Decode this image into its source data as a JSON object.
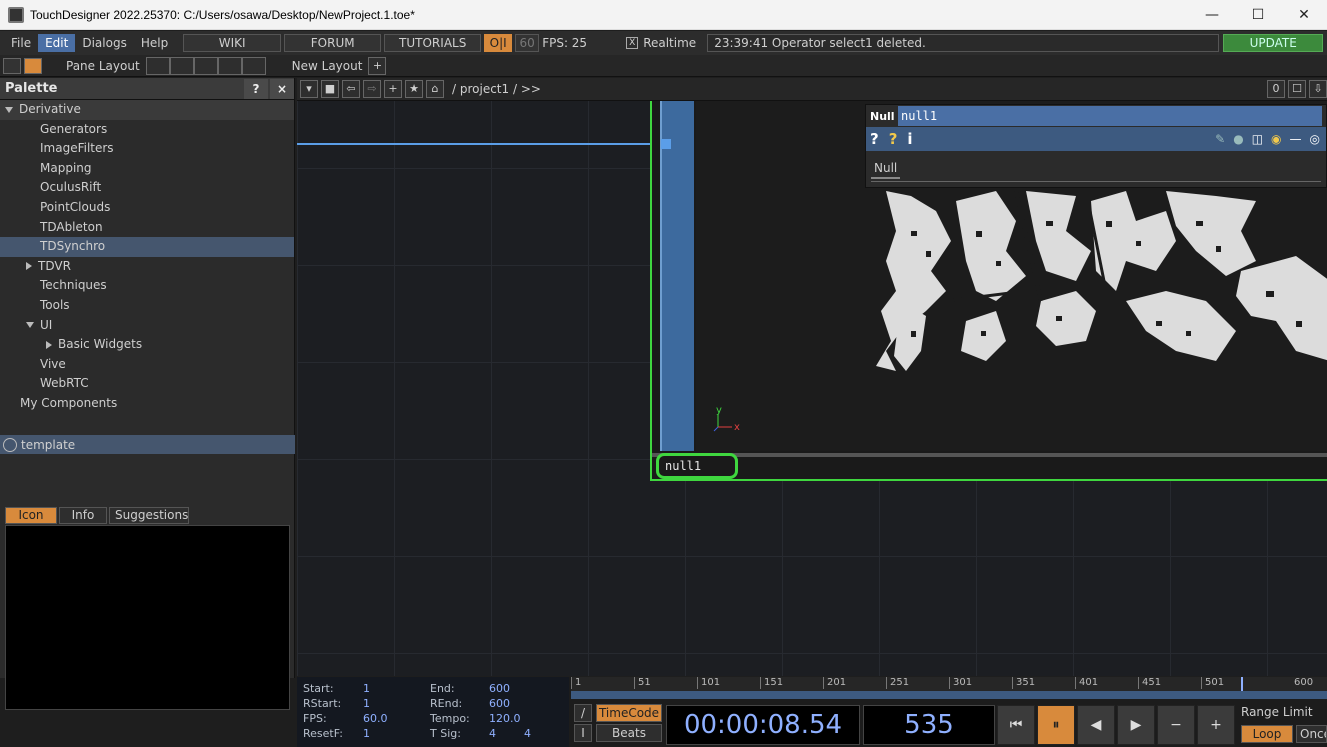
{
  "window": {
    "title": "TouchDesigner 2022.25370: C:/Users/osawa/Desktop/NewProject.1.toe*",
    "min_glyph": "—",
    "max_glyph": "☐",
    "close_glyph": "✕"
  },
  "menu": {
    "items": [
      "File",
      "Edit",
      "Dialogs",
      "Help"
    ],
    "active": "Edit",
    "wiki": "WIKI",
    "forum": "FORUM",
    "tutorials": "TUTORIALS",
    "oi": "O|I",
    "fps_cap": "60",
    "fps_label": "FPS:  25",
    "realtime_check": "X",
    "realtime": "Realtime",
    "status": "23:39:41 Operator select1 deleted.",
    "update": "UPDATE"
  },
  "layoutbar": {
    "pane_layout": "Pane Layout",
    "new_layout": "New Layout",
    "plus": "+"
  },
  "palette": {
    "title": "Palette",
    "help": "?",
    "close": "×",
    "items": [
      {
        "label": "Derivative",
        "indent": 0,
        "expand": "open",
        "group": true
      },
      {
        "label": "Generators",
        "indent": 2
      },
      {
        "label": "ImageFilters",
        "indent": 2
      },
      {
        "label": "Mapping",
        "indent": 2
      },
      {
        "label": "OculusRift",
        "indent": 2
      },
      {
        "label": "PointClouds",
        "indent": 2
      },
      {
        "label": "TDAbleton",
        "indent": 2
      },
      {
        "label": "TDSynchro",
        "indent": 2,
        "selected": true
      },
      {
        "label": "TDVR",
        "indent": 1,
        "expand": "closed"
      },
      {
        "label": "Techniques",
        "indent": 2
      },
      {
        "label": "Tools",
        "indent": 2
      },
      {
        "label": "UI",
        "indent": 1,
        "expand": "open"
      },
      {
        "label": "Basic Widgets",
        "indent": 2,
        "expand": "closed"
      },
      {
        "label": "Vive",
        "indent": 2
      },
      {
        "label": "WebRTC",
        "indent": 2
      },
      {
        "label": "My Components",
        "indent": 1
      }
    ],
    "template": "template",
    "tabs": [
      "Icon",
      "Info",
      "Suggestions"
    ],
    "active_tab": "Icon"
  },
  "network": {
    "path": "/ project1 / >>",
    "counter": "0",
    "node_name": "null1",
    "axis_y": "y",
    "axis_x": "x"
  },
  "param": {
    "type": "Null",
    "name": "null1",
    "tab": "Null",
    "icons": [
      "?",
      "?",
      "i"
    ]
  },
  "timeline": {
    "start_k": "Start:",
    "start_v": "1",
    "rstart_k": "RStart:",
    "rstart_v": "1",
    "fps_k": "FPS:",
    "fps_v": "60.0",
    "resetf_k": "ResetF:",
    "resetf_v": "1",
    "end_k": "End:",
    "end_v": "600",
    "rend_k": "REnd:",
    "rend_v": "600",
    "tempo_k": "Tempo:",
    "tempo_v": "120.0",
    "tsig_k": "T Sig:",
    "tsig_v1": "4",
    "tsig_v2": "4",
    "ticks": [
      "1",
      "51",
      "101",
      "151",
      "201",
      "251",
      "301",
      "351",
      "401",
      "451",
      "501",
      "600"
    ],
    "timecode_btn": "TimeCode",
    "beats_btn": "Beats",
    "timecode": "00:00:08.54",
    "frame": "535",
    "range_limit": "Range Limit",
    "loop": "Loop",
    "once": "Once",
    "accent": "#d88a3c"
  }
}
